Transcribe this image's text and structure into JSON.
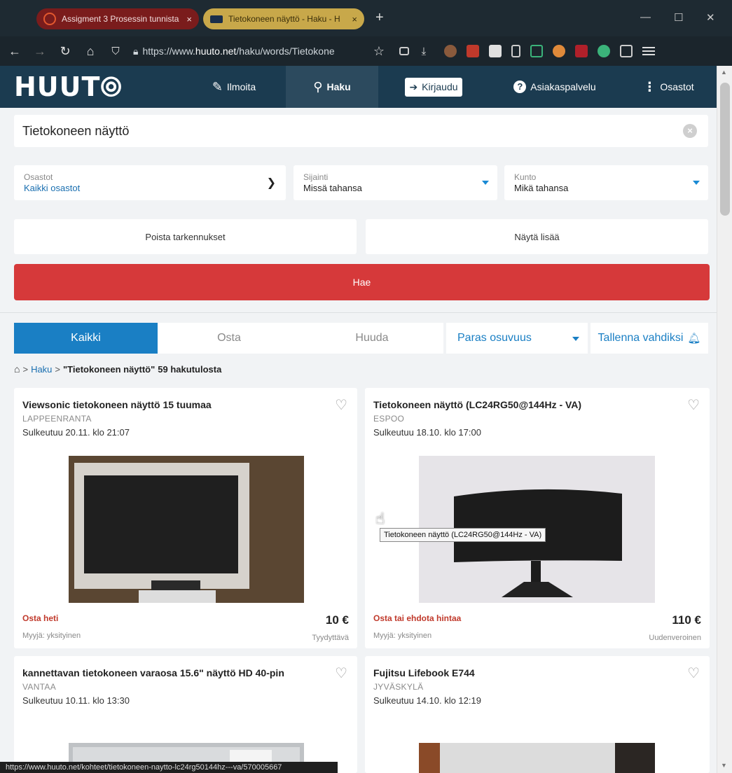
{
  "browser": {
    "tabs": [
      {
        "label": "Assigment 3 Prosessin tunnista",
        "close": "×"
      },
      {
        "label": "Tietokoneen näyttö - Haku - H",
        "close": "×"
      }
    ],
    "new_tab": "+",
    "url_prefix": "https://www.",
    "url_host": "huuto.net",
    "url_rest": "/haku/words/Tietokone",
    "status_url": "https://www.huuto.net/kohteet/tietokoneen-naytto-lc24rg50144hz---va/570005667"
  },
  "header": {
    "logo": "HUUT⦾",
    "nav": [
      {
        "label": "Ilmoita",
        "icon": "edit-icon"
      },
      {
        "label": "Haku",
        "icon": "search-icon"
      },
      {
        "label": "Kirjaudu",
        "icon": "login-icon"
      },
      {
        "label": "Asiakaspalvelu",
        "icon": "help-icon"
      },
      {
        "label": "Osastot",
        "icon": "menu-dots-icon"
      }
    ]
  },
  "search": {
    "value": "Tietokoneen näyttö"
  },
  "filters": {
    "osastot": {
      "label": "Osastot",
      "value": "Kaikki osastot"
    },
    "sijainti": {
      "label": "Sijainti",
      "value": "Missä tahansa"
    },
    "kunto": {
      "label": "Kunto",
      "value": "Mikä tahansa"
    }
  },
  "buttons": {
    "clear_filters": "Poista tarkennukset",
    "show_more": "Näytä lisää",
    "search": "Hae"
  },
  "segments": {
    "all": "Kaikki",
    "buy": "Osta",
    "bid": "Huuda",
    "sort": "Paras osuvuus",
    "save": "Tallenna vahdiksi"
  },
  "breadcrumb": {
    "sep": ">",
    "haku": "Haku",
    "query": "\"Tietokoneen näyttö\"",
    "count": "59 hakutulosta"
  },
  "listings": [
    {
      "title": "Viewsonic tietokoneen näyttö 15 tuumaa",
      "city": "LAPPEENRANTA",
      "closes": "Sulkeutuu 20.11. klo 21:07",
      "buy_type": "Osta heti",
      "price": "10 €",
      "seller": "Myyjä: yksityinen",
      "condition": "Tyydyttävä"
    },
    {
      "title": "Tietokoneen näyttö (LC24RG50@144Hz - VA)",
      "city": "ESPOO",
      "closes": "Sulkeutuu 18.10. klo 17:00",
      "buy_type": "Osta tai ehdota hintaa",
      "price": "110 €",
      "seller": "Myyjä: yksityinen",
      "condition": "Uudenveroinen"
    },
    {
      "title": "kannettavan tietokoneen varaosa 15.6\" näyttö HD 40-pin",
      "city": "VANTAA",
      "closes": "Sulkeutuu 10.11. klo 13:30"
    },
    {
      "title": "Fujitsu Lifebook E744",
      "city": "JYVÄSKYLÄ",
      "closes": "Sulkeutuu 14.10. klo 12:19"
    }
  ],
  "tooltip": "Tietokoneen näyttö (LC24RG50@144Hz - VA)"
}
